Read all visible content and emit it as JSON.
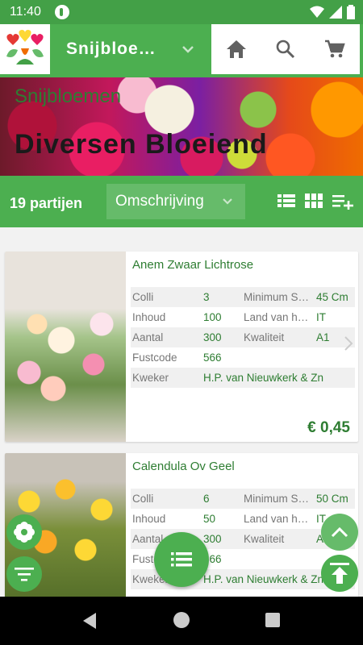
{
  "status_bar": {
    "time": "11:40"
  },
  "app_bar": {
    "title": "Snijbloemen",
    "title_display": "Snijbloe…"
  },
  "hero": {
    "subtitle": "Snijbloemen",
    "title": "Diversen Bloeiend"
  },
  "filter_bar": {
    "count": "19 partijen",
    "sort_label": "Omschrijving"
  },
  "labels": {
    "colli": "Colli",
    "inhoud": "Inhoud",
    "aantal": "Aantal",
    "fustcode": "Fustcode",
    "kweker": "Kweker",
    "minimum": "Minimum S…",
    "land": "Land van h…",
    "kwaliteit": "Kwaliteit"
  },
  "products": [
    {
      "name": "Anem Zwaar Lichtrose",
      "colli": "3",
      "inhoud": "100",
      "aantal": "300",
      "fustcode": "566",
      "kweker": "H.P. van Nieuwkerk & Zn",
      "minimum": "45 Cm",
      "land": "IT",
      "kwaliteit": "A1",
      "price": "€ 0,45"
    },
    {
      "name": "Calendula Ov Geel",
      "colli": "6",
      "inhoud": "50",
      "aantal": "300",
      "fustcode": "566",
      "kweker": "H.P. van Nieuwkerk & Zn",
      "minimum": "50 Cm",
      "land": "IT",
      "kwaliteit": "A1"
    }
  ],
  "colors": {
    "primary": "#4caf50",
    "status": "#43a047",
    "text_green": "#2e7d32"
  }
}
